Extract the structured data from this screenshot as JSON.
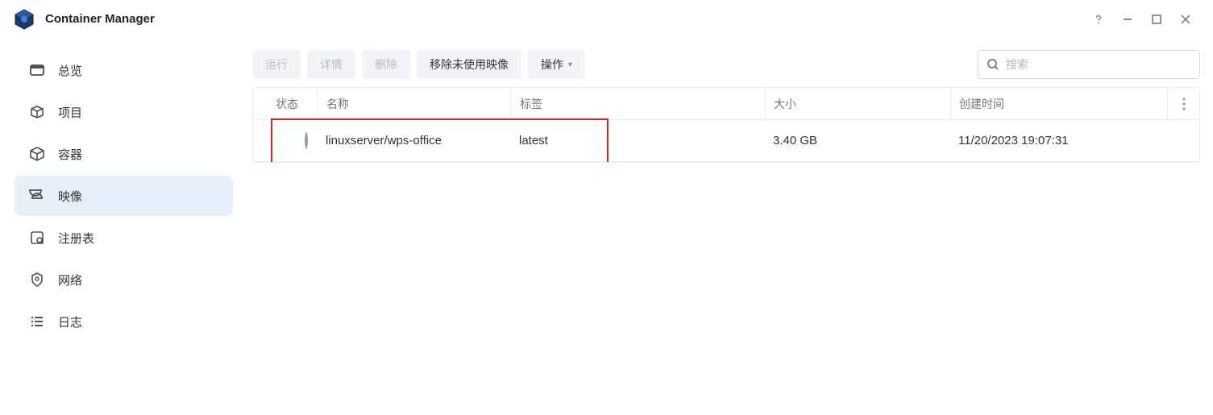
{
  "app": {
    "title": "Container Manager"
  },
  "sidebar": {
    "items": [
      {
        "key": "overview",
        "label": "总览",
        "icon": "overview-icon"
      },
      {
        "key": "project",
        "label": "项目",
        "icon": "project-icon"
      },
      {
        "key": "container",
        "label": "容器",
        "icon": "container-icon"
      },
      {
        "key": "image",
        "label": "映像",
        "icon": "image-icon",
        "active": true
      },
      {
        "key": "registry",
        "label": "注册表",
        "icon": "registry-icon"
      },
      {
        "key": "network",
        "label": "网络",
        "icon": "network-icon"
      },
      {
        "key": "log",
        "label": "日志",
        "icon": "log-icon"
      }
    ]
  },
  "toolbar": {
    "run": "运行",
    "detail": "详情",
    "delete": "删除",
    "remove_unused": "移除未使用映像",
    "action": "操作",
    "search_placeholder": "搜索"
  },
  "table": {
    "headers": {
      "status": "状态",
      "name": "名称",
      "tag": "标签",
      "size": "大小",
      "created": "创建时间"
    },
    "rows": [
      {
        "status": "stopped",
        "name": "linuxserver/wps-office",
        "tag": "latest",
        "size": "3.40 GB",
        "created": "11/20/2023 19:07:31"
      }
    ]
  }
}
